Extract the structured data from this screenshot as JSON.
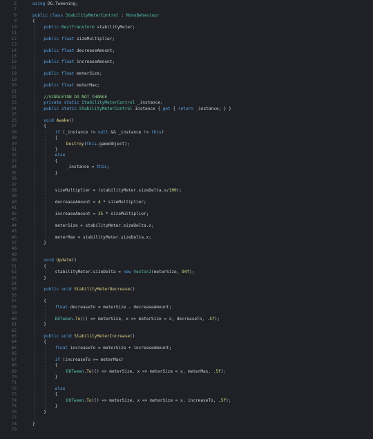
{
  "editor": {
    "lines": [
      {
        "n": "6",
        "indent": 0,
        "tokens": [
          [
            "kw",
            "using"
          ],
          [
            "tx",
            " DG.Tweening;"
          ]
        ]
      },
      {
        "n": "7",
        "indent": 0,
        "tokens": []
      },
      {
        "n": "8",
        "indent": 0,
        "tokens": [
          [
            "kw",
            "public class "
          ],
          [
            "ty",
            "StabilityMeterControl"
          ],
          [
            "tx",
            " : "
          ],
          [
            "ty",
            "MonoBehaviour"
          ]
        ]
      },
      {
        "n": "9",
        "indent": 0,
        "tokens": [
          [
            "tx",
            "{"
          ]
        ]
      },
      {
        "n": "10",
        "indent": 1,
        "tokens": [
          [
            "kw",
            "public "
          ],
          [
            "ty",
            "RectTransform"
          ],
          [
            "tx",
            " stabilityMeter;"
          ]
        ]
      },
      {
        "n": "11",
        "indent": 0,
        "tokens": []
      },
      {
        "n": "12",
        "indent": 1,
        "tokens": [
          [
            "kw",
            "public float"
          ],
          [
            "tx",
            " sizeMultiplier;"
          ]
        ]
      },
      {
        "n": "13",
        "indent": 0,
        "tokens": []
      },
      {
        "n": "14",
        "indent": 1,
        "tokens": [
          [
            "kw",
            "public float"
          ],
          [
            "tx",
            " decreaseAmount;"
          ]
        ]
      },
      {
        "n": "15",
        "indent": 0,
        "tokens": []
      },
      {
        "n": "16",
        "indent": 1,
        "tokens": [
          [
            "kw",
            "public float"
          ],
          [
            "tx",
            " increaseAmount;"
          ]
        ]
      },
      {
        "n": "17",
        "indent": 0,
        "tokens": []
      },
      {
        "n": "18",
        "indent": 1,
        "tokens": [
          [
            "kw",
            "public float"
          ],
          [
            "tx",
            " meterSize;"
          ]
        ]
      },
      {
        "n": "19",
        "indent": 0,
        "tokens": []
      },
      {
        "n": "20",
        "indent": 1,
        "tokens": [
          [
            "kw",
            "public float"
          ],
          [
            "tx",
            " meterMax;"
          ]
        ]
      },
      {
        "n": "21",
        "indent": 0,
        "tokens": []
      },
      {
        "n": "22",
        "indent": 1,
        "tokens": [
          [
            "cm",
            "//SINGLETON DO NOT CHANGE"
          ]
        ]
      },
      {
        "n": "23",
        "indent": 1,
        "tokens": [
          [
            "kw",
            "private static "
          ],
          [
            "ty",
            "StabilityMeterControl"
          ],
          [
            "tx",
            " _instance;"
          ]
        ]
      },
      {
        "n": "24",
        "indent": 1,
        "tokens": [
          [
            "kw",
            "public static "
          ],
          [
            "ty",
            "StabilityMeterControl"
          ],
          [
            "tx",
            " Instance { "
          ],
          [
            "kw",
            "get"
          ],
          [
            "tx",
            " { "
          ],
          [
            "kw",
            "return"
          ],
          [
            "tx",
            " _instance; } }"
          ]
        ]
      },
      {
        "n": "25",
        "indent": 0,
        "tokens": []
      },
      {
        "n": "26",
        "indent": 1,
        "tokens": [
          [
            "kw",
            "void "
          ],
          [
            "fn",
            "Awake"
          ],
          [
            "tx",
            "()"
          ]
        ]
      },
      {
        "n": "27",
        "indent": 1,
        "tokens": [
          [
            "tx",
            "{"
          ]
        ]
      },
      {
        "n": "28",
        "indent": 2,
        "tokens": [
          [
            "kw",
            "if"
          ],
          [
            "tx",
            " (_instance != "
          ],
          [
            "kw",
            "null"
          ],
          [
            "tx",
            " && _instance != "
          ],
          [
            "kw",
            "this"
          ],
          [
            "tx",
            ")"
          ]
        ]
      },
      {
        "n": "29",
        "indent": 2,
        "tokens": [
          [
            "tx",
            "{"
          ]
        ]
      },
      {
        "n": "30",
        "indent": 3,
        "tokens": [
          [
            "fn",
            "Destroy"
          ],
          [
            "tx",
            "("
          ],
          [
            "kw",
            "this"
          ],
          [
            "tx",
            ".gameObject);"
          ]
        ]
      },
      {
        "n": "31",
        "indent": 2,
        "tokens": [
          [
            "tx",
            "}"
          ]
        ]
      },
      {
        "n": "32",
        "indent": 2,
        "tokens": [
          [
            "kw",
            "else"
          ]
        ]
      },
      {
        "n": "33",
        "indent": 2,
        "tokens": [
          [
            "tx",
            "{"
          ]
        ]
      },
      {
        "n": "34",
        "indent": 3,
        "tokens": [
          [
            "tx",
            "_instance = "
          ],
          [
            "kw",
            "this"
          ],
          [
            "tx",
            ";"
          ]
        ]
      },
      {
        "n": "35",
        "indent": 2,
        "tokens": [
          [
            "tx",
            "}"
          ]
        ]
      },
      {
        "n": "36",
        "indent": 0,
        "tokens": []
      },
      {
        "n": "37",
        "indent": 0,
        "tokens": []
      },
      {
        "n": "38",
        "indent": 2,
        "tokens": [
          [
            "tx",
            "sizeMultiplier = (stabilityMeter.sizeDelta.x/"
          ],
          [
            "st",
            "100"
          ],
          [
            "tx",
            ");"
          ]
        ]
      },
      {
        "n": "39",
        "indent": 0,
        "tokens": []
      },
      {
        "n": "40",
        "indent": 2,
        "tokens": [
          [
            "tx",
            "decreaseAmount = "
          ],
          [
            "st",
            "4"
          ],
          [
            "tx",
            " * sizeMultiplier;"
          ]
        ]
      },
      {
        "n": "41",
        "indent": 0,
        "tokens": []
      },
      {
        "n": "42",
        "indent": 2,
        "tokens": [
          [
            "tx",
            "increaseAmount = "
          ],
          [
            "st",
            "25"
          ],
          [
            "tx",
            " * sizeMultiplier;"
          ]
        ]
      },
      {
        "n": "43",
        "indent": 0,
        "tokens": []
      },
      {
        "n": "44",
        "indent": 2,
        "tokens": [
          [
            "tx",
            "meterSize = stabilityMeter.sizeDelta.x;"
          ]
        ]
      },
      {
        "n": "45",
        "indent": 0,
        "tokens": []
      },
      {
        "n": "46",
        "indent": 2,
        "tokens": [
          [
            "tx",
            "meterMax = stabilityMeter.sizeDelta.x;"
          ]
        ]
      },
      {
        "n": "47",
        "indent": 1,
        "tokens": [
          [
            "tx",
            "}"
          ]
        ]
      },
      {
        "n": "48",
        "indent": 0,
        "tokens": []
      },
      {
        "n": "49",
        "indent": 0,
        "tokens": []
      },
      {
        "n": "50",
        "indent": 1,
        "tokens": [
          [
            "kw",
            "void "
          ],
          [
            "fn",
            "Update"
          ],
          [
            "tx",
            "()"
          ]
        ]
      },
      {
        "n": "51",
        "indent": 1,
        "tokens": [
          [
            "tx",
            "{"
          ]
        ]
      },
      {
        "n": "52",
        "indent": 2,
        "tokens": [
          [
            "tx",
            "stabilityMeter.sizeDelta = "
          ],
          [
            "kw",
            "new "
          ],
          [
            "ty",
            "Vector2"
          ],
          [
            "tx",
            "(meterSize, "
          ],
          [
            "st",
            "94f"
          ],
          [
            "tx",
            ");"
          ]
        ]
      },
      {
        "n": "53",
        "indent": 1,
        "tokens": [
          [
            "tx",
            "}"
          ]
        ]
      },
      {
        "n": "54",
        "indent": 0,
        "tokens": []
      },
      {
        "n": "55",
        "indent": 1,
        "tokens": [
          [
            "kw",
            "public void "
          ],
          [
            "fn",
            "StabilityMeterDecrease"
          ],
          [
            "tx",
            "()"
          ]
        ]
      },
      {
        "n": "56",
        "indent": 0,
        "tokens": []
      },
      {
        "n": "57",
        "indent": 1,
        "tokens": [
          [
            "tx",
            "{"
          ]
        ]
      },
      {
        "n": "58",
        "indent": 2,
        "tokens": [
          [
            "kw",
            "float"
          ],
          [
            "tx",
            " decreaseTo = meterSize - decreaseAmount;"
          ]
        ]
      },
      {
        "n": "59",
        "indent": 0,
        "tokens": []
      },
      {
        "n": "60",
        "indent": 2,
        "tokens": [
          [
            "ty",
            "DOTween"
          ],
          [
            "tx",
            "."
          ],
          [
            "fn",
            "To"
          ],
          [
            "tx",
            "(() => meterSize, x => meterSize = x, decreaseTo, "
          ],
          [
            "st",
            ".5f"
          ],
          [
            "tx",
            ");"
          ]
        ]
      },
      {
        "n": "61",
        "indent": 1,
        "tokens": [
          [
            "tx",
            "}"
          ]
        ]
      },
      {
        "n": "62",
        "indent": 0,
        "tokens": []
      },
      {
        "n": "63",
        "indent": 1,
        "tokens": [
          [
            "kw",
            "public void "
          ],
          [
            "fn",
            "StabilityMeterIncrease"
          ],
          [
            "tx",
            "()"
          ]
        ]
      },
      {
        "n": "64",
        "indent": 1,
        "tokens": [
          [
            "tx",
            "{"
          ]
        ]
      },
      {
        "n": "65",
        "indent": 2,
        "tokens": [
          [
            "kw",
            "float"
          ],
          [
            "tx",
            " increaseTo = meterSize + increaseAmount;"
          ]
        ]
      },
      {
        "n": "66",
        "indent": 0,
        "tokens": []
      },
      {
        "n": "67",
        "indent": 2,
        "tokens": [
          [
            "kw",
            "if"
          ],
          [
            "tx",
            " (increaseTo >= meterMax)"
          ]
        ]
      },
      {
        "n": "68",
        "indent": 2,
        "tokens": [
          [
            "tx",
            "{"
          ]
        ]
      },
      {
        "n": "69",
        "indent": 3,
        "tokens": [
          [
            "ty",
            "DOTween"
          ],
          [
            "tx",
            "."
          ],
          [
            "fn",
            "To"
          ],
          [
            "tx",
            "(() => meterSize, x => meterSize = x, meterMax, "
          ],
          [
            "st",
            ".5f"
          ],
          [
            "tx",
            ");"
          ]
        ]
      },
      {
        "n": "70",
        "indent": 2,
        "tokens": [
          [
            "tx",
            "}"
          ]
        ]
      },
      {
        "n": "71",
        "indent": 0,
        "tokens": []
      },
      {
        "n": "72",
        "indent": 2,
        "tokens": [
          [
            "kw",
            "else"
          ]
        ]
      },
      {
        "n": "73",
        "indent": 2,
        "tokens": [
          [
            "tx",
            "{"
          ]
        ]
      },
      {
        "n": "74",
        "indent": 3,
        "tokens": [
          [
            "ty",
            "DOTween"
          ],
          [
            "tx",
            "."
          ],
          [
            "fn",
            "To"
          ],
          [
            "tx",
            "(() => meterSize, x => meterSize = x, increaseTo, "
          ],
          [
            "st",
            ".5f"
          ],
          [
            "tx",
            ");"
          ]
        ]
      },
      {
        "n": "75",
        "indent": 2,
        "tokens": [
          [
            "tx",
            "}"
          ]
        ]
      },
      {
        "n": "76",
        "indent": 1,
        "tokens": [
          [
            "tx",
            "}"
          ]
        ]
      },
      {
        "n": "77",
        "indent": 0,
        "tokens": []
      },
      {
        "n": "78",
        "indent": 0,
        "tokens": [
          [
            "tx",
            "}"
          ]
        ]
      },
      {
        "n": "79",
        "indent": 0,
        "tokens": []
      }
    ]
  }
}
